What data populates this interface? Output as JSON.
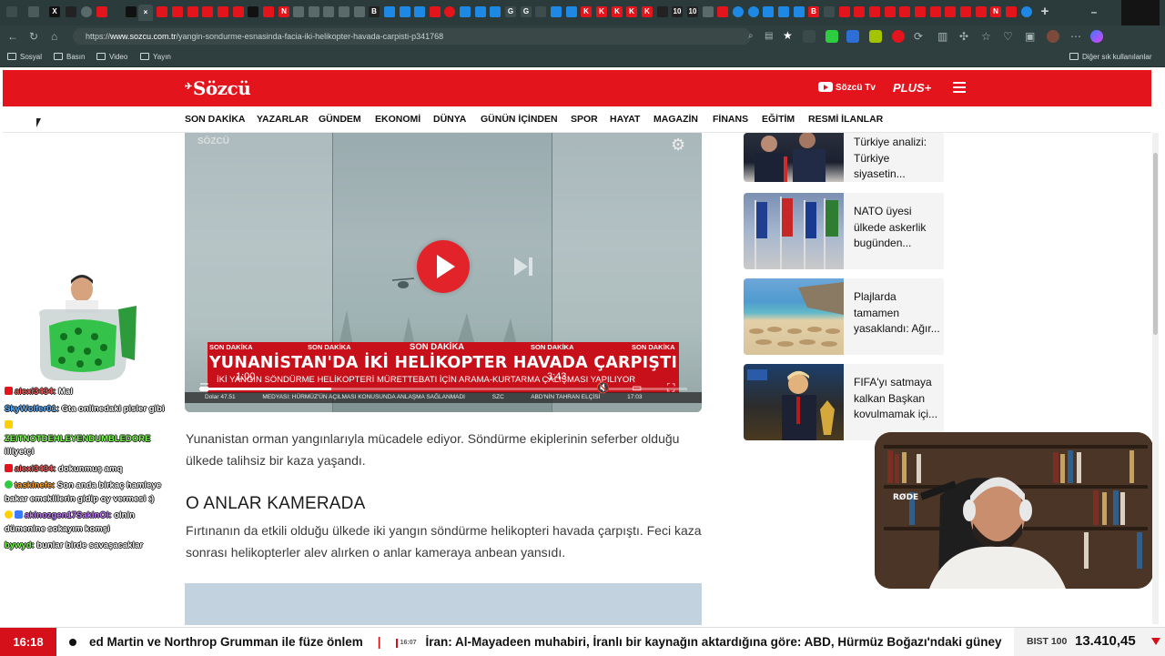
{
  "browser": {
    "url_prefix": "https://",
    "url_domain": "www.sozcu.com.tr",
    "url_path": "/yangin-sondurme-esnasinda-facia-iki-helikopter-havada-carpisti-p341768",
    "tab_favicons": [
      "X",
      "N",
      "B",
      "G",
      "G",
      "K",
      "K",
      "K",
      "K",
      "K",
      "10",
      "10",
      "B",
      "N"
    ],
    "bookmarks": [
      "Sosyal",
      "Basın",
      "Video",
      "Yayın"
    ],
    "other_bookmarks": "Diğer sık kullanılanlar",
    "accent": "#2b3a3a"
  },
  "site": {
    "logo": "Sözcü",
    "tv_label": "Sözcü Tv",
    "plus_label": "PLUS+",
    "brand_color": "#e4141c",
    "nav": [
      "SON DAKİKA",
      "YAZARLAR",
      "GÜNDEM",
      "EKONOMİ",
      "DÜNYA",
      "GÜNÜN İÇİNDEN",
      "SPOR",
      "HAYAT",
      "MAGAZİN",
      "FİNANS",
      "EĞİTİM",
      "RESMİ İLANLAR"
    ]
  },
  "video": {
    "watermark": "SÖZCÜ",
    "son_dakika": "SON DAKİKA",
    "headline": "YUNANİSTAN'DA İKİ HELİKOPTER HAVADA ÇARPIŞTI",
    "subline": "İKİ YANGIN SÖNDÜRME HELİKOPTERİ MÜRETTEBATI İÇİN ARAMA-KURTARMA ÇALIŞMASI YAPILIYOR",
    "ticker_items": [
      "Dolar 47.51",
      "MEDYASI: HÜRMÜZ'ÜN AÇILMASI KONUSUNDA ANLAŞMA SAĞLANMADI",
      "SZC",
      "ABD'NİN TAHRAN ELÇİSİ",
      "17:03"
    ],
    "current_time": "1:00",
    "duration": "3:43",
    "progress": 0.27
  },
  "article": {
    "intro": "Yunanistan orman yangınlarıyla mücadele ediyor. Söndürme ekiplerinin seferber olduğu ülkede talihsiz bir kaza yaşandı.",
    "subhead": "O ANLAR KAMERADA",
    "body": "Fırtınanın da etkili olduğu ülkede iki yangın söndürme helikopteri havada çarpıştı. Feci kaza sonrası helikopterler alev alırken o anlar kameraya anbean yansıdı."
  },
  "related": [
    {
      "title": "Türkiye analizi: Türkiye siyasetin..."
    },
    {
      "title": "NATO üyesi ülkede askerlik bugünden..."
    },
    {
      "title": "Plajlarda tamamen yasaklandı: Ağır..."
    },
    {
      "title": "FIFA'yı satmaya kalkan Başkan kovulmamak içi..."
    }
  ],
  "chat": [
    {
      "name": "alexi3434:",
      "msg": "Mal",
      "color": "#ff4d4d"
    },
    {
      "name": "SkyWolfer01:",
      "msg": "Gta onlinedaki pisler gibi",
      "color": "#4fa3ff"
    },
    {
      "name": "ZEITNOTDEHLEYENDUMBLEDORE",
      "msg": "illiyetçi",
      "color": "#7cff4f"
    },
    {
      "name": "alexi3434:",
      "msg": "dokunmuş amq",
      "color": "#ff4d4d"
    },
    {
      "name": "taskinefe:",
      "msg": "Son anda birkaç hamleye bakar emeklilerin gidip oy vermesi :)",
      "color": "#ff9d2e"
    },
    {
      "name": "akinozgen17SakinOl:",
      "msg": "olnin dümenine sokayım komşi",
      "color": "#c47bff"
    },
    {
      "name": "bywyd:",
      "msg": "bunlar birde savaşacaklar",
      "color": "#7cff4f"
    }
  ],
  "ticker": {
    "time": "16:18",
    "item1": "ed Martin ve Northrop Grumman ile füze önlem",
    "separator": "|",
    "item2_time": "16:07",
    "item2": "İran: Al-Mayadeen muhabiri, İranlı bir kaynağın aktardığına göre: ABD, Hürmüz Boğazı'ndaki güney",
    "bist_label": "BIST 100",
    "bist_value": "13.410,45"
  }
}
